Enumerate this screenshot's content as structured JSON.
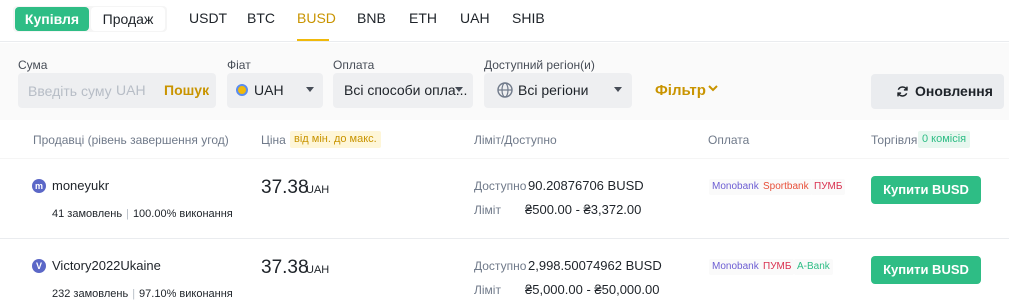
{
  "trade_side": {
    "buy_label": "Купівля",
    "sell_label": "Продаж",
    "selected": "buy"
  },
  "asset_tabs": [
    "USDT",
    "BTC",
    "BUSD",
    "BNB",
    "ETH",
    "UAH",
    "SHIB"
  ],
  "selected_asset": "BUSD",
  "filters": {
    "amount": {
      "label": "Сума",
      "placeholder": "Введіть суму",
      "value": "",
      "currency": "UAH",
      "search_label": "Пошук"
    },
    "fiat": {
      "label": "Фіат",
      "value": "UAH"
    },
    "payment": {
      "label": "Оплата",
      "value": "Всі способи опла..."
    },
    "region": {
      "label": "Доступний регіон(и)",
      "value": "Всі регіони"
    },
    "filter_label": "Фільтр",
    "refresh_label": "Оновлення"
  },
  "table_header": {
    "sellers": "Продавці (рівень завершення угод)",
    "price": "Ціна",
    "price_badge": "від мін. до макс.",
    "limit": "Ліміт/Доступно",
    "payment": "Оплата",
    "trade": "Торгівля",
    "trade_badge": "0 комісія"
  },
  "offers": [
    {
      "avatar_letter": "m",
      "seller": "moneyukr",
      "orders": "41 замовлень",
      "completion": "100.00% виконання",
      "price": "37.38",
      "price_currency": "UAH",
      "available_label": "Доступно",
      "available": "90.20876706 BUSD",
      "limit_label": "Ліміт",
      "limit": "₴500.00 - ₴3,372.00",
      "payments": [
        "Monobank",
        "Sportbank",
        "ПУМБ"
      ],
      "action_label": "Купити BUSD"
    },
    {
      "avatar_letter": "V",
      "seller": "Victory2022Ukaine",
      "orders": "232 замовлень",
      "completion": "97.10% виконання",
      "price": "37.38",
      "price_currency": "UAH",
      "available_label": "Доступно",
      "available": "2,998.50074962 BUSD",
      "limit_label": "Ліміт",
      "limit": "₴5,000.00 - ₴50,000.00",
      "payments": [
        "Monobank",
        "ПУМБ",
        "A-Bank"
      ],
      "action_label": "Купити BUSD"
    }
  ],
  "colors": {
    "buy_green": "#2ebd85",
    "accent_yellow": "#f0b90b",
    "accent_text": "#c99400"
  }
}
